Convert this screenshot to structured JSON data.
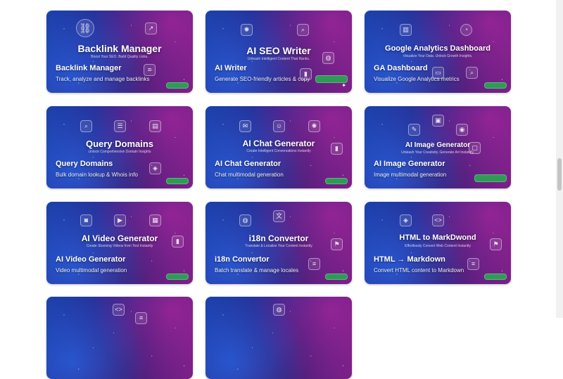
{
  "cards": [
    {
      "hero_title": "Backlink Manager",
      "hero_subtitle": "Boost Your SEO. Build Quality Links.",
      "title": "Backlink Manager",
      "description": "Track, analyze and manage backlinks",
      "icons": [
        "link-icon",
        "trend-chart-icon",
        "document-icon"
      ]
    },
    {
      "hero_title": "AI SEO Writer",
      "hero_subtitle": "Unleash Intelligent Content That Ranks.",
      "title": "AI Writer",
      "description": "Generate SEO-friendly articles & copy",
      "icons": [
        "brain-icon",
        "search-doc-icon",
        "globe-icon",
        "chart-icon"
      ]
    },
    {
      "hero_title": "Google Analytics Dashboard",
      "hero_subtitle": "Visualize Your Data. Unlock Growth Insights.",
      "title": "GA Dashboard",
      "description": "Visualize Google Analytics metrics",
      "icons": [
        "bar-chart-icon",
        "pie-chart-icon",
        "search-icon",
        "monitor-icon"
      ]
    },
    {
      "hero_title": "Query Domains",
      "hero_subtitle": "Unlock Comprehensive Domain Insights",
      "title": "Query Domains",
      "description": "Bulk domain lookup & Whois info",
      "icons": [
        "search-icon",
        "list-icon",
        "server-icon",
        "shield-icon"
      ]
    },
    {
      "hero_title": "AI Chat Generator",
      "hero_subtitle": "Create Intelligent Conversations Instantly",
      "title": "AI Chat Generator",
      "description": "Chat multimodal generation",
      "icons": [
        "chat-icon",
        "robot-icon",
        "brain-icon",
        "chart-icon"
      ]
    },
    {
      "hero_title": "AI Image Generator",
      "hero_subtitle": "Unleash Your Creativity. Generate Art Instantly.",
      "title": "AI Image Generator",
      "description": "Image multimodal generation",
      "icons": [
        "brush-icon",
        "image-icon",
        "palette-icon",
        "frame-icon"
      ]
    },
    {
      "hero_title": "AI Video Generator",
      "hero_subtitle": "Create Stunning Videos from Text Instantly",
      "title": "AI Video Generator",
      "description": "Video multimodal generation",
      "icons": [
        "camera-icon",
        "clapper-icon",
        "film-icon",
        "chart-icon"
      ]
    },
    {
      "hero_title": "i18n Convertor",
      "hero_subtitle": "Translate & Localize Your Content Instantly",
      "title": "i18n Convertor",
      "description": "Batch translate & manage locales",
      "icons": [
        "globe-icon",
        "translate-icon",
        "flag-icon",
        "document-icon"
      ]
    },
    {
      "hero_title": "HTML to MarkDwond",
      "hero_subtitle": "Effortlessly Convert Web Content Instantly",
      "title": "HTML → Markdown",
      "description": "Convert HTML content to Markdown",
      "icons": [
        "shield-icon",
        "code-icon",
        "flag-icon",
        "document-icon"
      ]
    },
    {
      "hero_title": "",
      "hero_subtitle": "",
      "title": "",
      "description": "",
      "icons": [
        "code-icon",
        "document-icon"
      ]
    },
    {
      "hero_title": "",
      "hero_subtitle": "",
      "title": "",
      "description": "",
      "icons": [
        "globe-icon"
      ]
    }
  ],
  "colors": {
    "card_blue": "#1a3ea8",
    "card_purple": "#7a1f86",
    "cta_green": "#2f9a56",
    "page_background": "#ffffff"
  }
}
